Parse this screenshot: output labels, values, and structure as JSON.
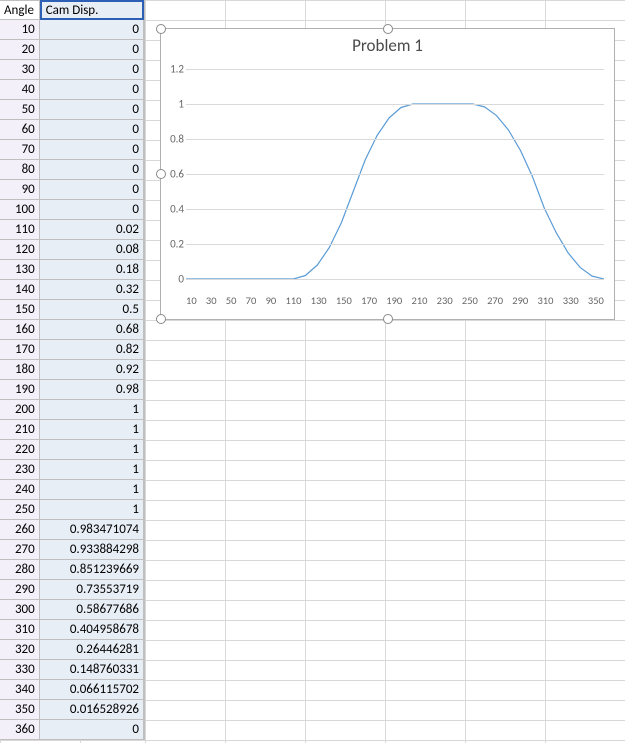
{
  "headers": {
    "a": "Angle",
    "b": "Cam Disp."
  },
  "rows": [
    {
      "angle": 10,
      "disp": "0"
    },
    {
      "angle": 20,
      "disp": "0"
    },
    {
      "angle": 30,
      "disp": "0"
    },
    {
      "angle": 40,
      "disp": "0"
    },
    {
      "angle": 50,
      "disp": "0"
    },
    {
      "angle": 60,
      "disp": "0"
    },
    {
      "angle": 70,
      "disp": "0"
    },
    {
      "angle": 80,
      "disp": "0"
    },
    {
      "angle": 90,
      "disp": "0"
    },
    {
      "angle": 100,
      "disp": "0"
    },
    {
      "angle": 110,
      "disp": "0.02"
    },
    {
      "angle": 120,
      "disp": "0.08"
    },
    {
      "angle": 130,
      "disp": "0.18"
    },
    {
      "angle": 140,
      "disp": "0.32"
    },
    {
      "angle": 150,
      "disp": "0.5"
    },
    {
      "angle": 160,
      "disp": "0.68"
    },
    {
      "angle": 170,
      "disp": "0.82"
    },
    {
      "angle": 180,
      "disp": "0.92"
    },
    {
      "angle": 190,
      "disp": "0.98"
    },
    {
      "angle": 200,
      "disp": "1"
    },
    {
      "angle": 210,
      "disp": "1"
    },
    {
      "angle": 220,
      "disp": "1"
    },
    {
      "angle": 230,
      "disp": "1"
    },
    {
      "angle": 240,
      "disp": "1"
    },
    {
      "angle": 250,
      "disp": "1"
    },
    {
      "angle": 260,
      "disp": "0.983471074"
    },
    {
      "angle": 270,
      "disp": "0.933884298"
    },
    {
      "angle": 280,
      "disp": "0.851239669"
    },
    {
      "angle": 290,
      "disp": "0.73553719"
    },
    {
      "angle": 300,
      "disp": "0.58677686"
    },
    {
      "angle": 310,
      "disp": "0.404958678"
    },
    {
      "angle": 320,
      "disp": "0.26446281"
    },
    {
      "angle": 330,
      "disp": "0.148760331"
    },
    {
      "angle": 340,
      "disp": "0.066115702"
    },
    {
      "angle": 350,
      "disp": "0.016528926"
    },
    {
      "angle": 360,
      "disp": "0"
    }
  ],
  "chart_data": {
    "type": "line",
    "title": "Problem 1",
    "xlabel": "",
    "ylabel": "",
    "ylim": [
      0,
      1.2
    ],
    "y_ticks": [
      0,
      0.2,
      0.4,
      0.6,
      0.8,
      1,
      1.2
    ],
    "x_ticks": [
      10,
      30,
      50,
      70,
      90,
      110,
      130,
      150,
      170,
      190,
      210,
      230,
      250,
      270,
      290,
      310,
      330,
      350
    ],
    "series": [
      {
        "name": "Cam Disp.",
        "color": "#5b9bd5",
        "x": [
          10,
          20,
          30,
          40,
          50,
          60,
          70,
          80,
          90,
          100,
          110,
          120,
          130,
          140,
          150,
          160,
          170,
          180,
          190,
          200,
          210,
          220,
          230,
          240,
          250,
          260,
          270,
          280,
          290,
          300,
          310,
          320,
          330,
          340,
          350,
          360
        ],
        "y": [
          0,
          0,
          0,
          0,
          0,
          0,
          0,
          0,
          0,
          0,
          0.02,
          0.08,
          0.18,
          0.32,
          0.5,
          0.68,
          0.82,
          0.92,
          0.98,
          1,
          1,
          1,
          1,
          1,
          1,
          0.983471074,
          0.933884298,
          0.851239669,
          0.73553719,
          0.58677686,
          0.404958678,
          0.26446281,
          0.148760331,
          0.066115702,
          0.016528926,
          0
        ]
      }
    ]
  }
}
